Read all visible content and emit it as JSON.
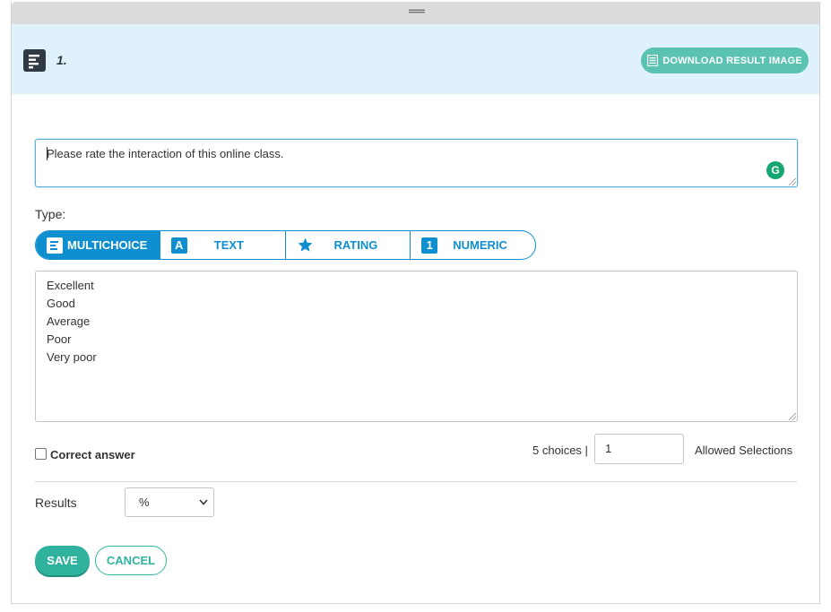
{
  "header": {
    "question_number": "1.",
    "download_label": "DOWNLOAD RESULT IMAGE"
  },
  "question": {
    "text": "Please rate the interaction of this online class."
  },
  "type": {
    "label": "Type:",
    "tabs": [
      {
        "label": "MULTICHOICE",
        "icon": "multichoice-icon",
        "active": true
      },
      {
        "label": "TEXT",
        "icon": "A",
        "active": false
      },
      {
        "label": "RATING",
        "icon": "star-icon",
        "active": false
      },
      {
        "label": "NUMERIC",
        "icon": "1",
        "active": false
      }
    ]
  },
  "choices": [
    "Excellent",
    "Good",
    "Average",
    "Poor",
    "Very poor"
  ],
  "correct_answer": {
    "label": "Correct answer",
    "checked": false
  },
  "selection": {
    "choices_count": "5 choices |",
    "allowed_value": "1",
    "allowed_label": "Allowed Selections"
  },
  "results": {
    "label": "Results",
    "selected": "%"
  },
  "actions": {
    "save_label": "SAVE",
    "cancel_label": "CANCEL"
  },
  "colors": {
    "accent_blue": "#0f8fd0",
    "accent_teal": "#2fb39e",
    "header_bg": "#dff1fa",
    "download_bg": "#5cc3b3"
  }
}
